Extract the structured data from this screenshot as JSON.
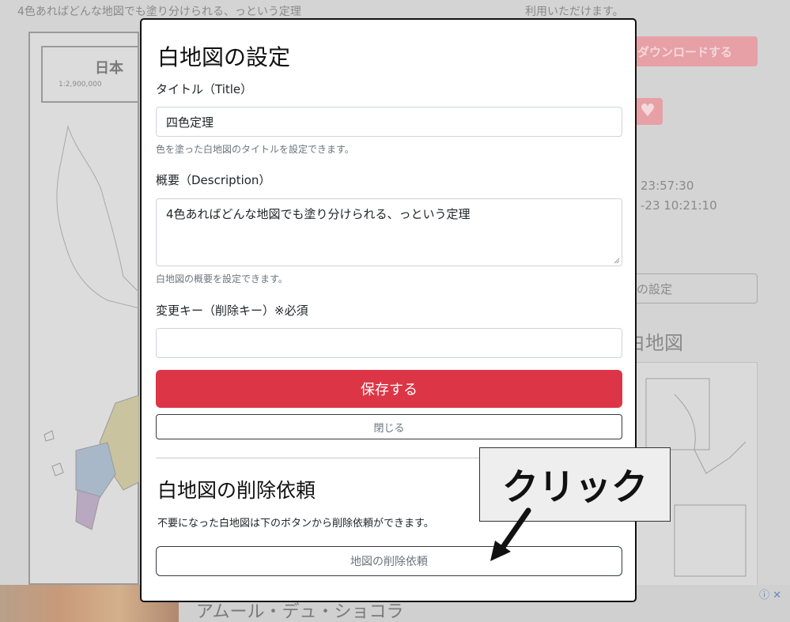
{
  "background": {
    "map_description": "4色あればどんな地図でも塗り分けられる、っという定理",
    "usage_note": "利用いただけます。",
    "map_legend_title": "日本",
    "map_scale": "1:2,900,000",
    "download_button": "でダウンロードする",
    "created_at": "23:57:30",
    "updated_at": "-23 10:21:10",
    "settings_button": "の設定",
    "related_heading": "白地図",
    "ad_text": "アムール・デュ・ショコラ",
    "ad_icons": "ⓘ ✕"
  },
  "modal": {
    "title": "白地図の設定",
    "title_field": {
      "label": "タイトル（Title）",
      "value": "四色定理",
      "help": "色を塗った白地図のタイトルを設定できます。"
    },
    "description_field": {
      "label": "概要（Description）",
      "value": "4色あればどんな地図でも塗り分けられる、っという定理",
      "help": "白地図の概要を設定できます。"
    },
    "key_field": {
      "label": "変更キー（削除キー）※必須",
      "value": ""
    },
    "save_button": "保存する",
    "close_button": "閉じる",
    "delete_section": {
      "title": "白地図の削除依頼",
      "description": "不要になった白地図は下のボタンから削除依頼ができます。",
      "button": "地図の削除依頼"
    }
  },
  "annotation": {
    "callout_text": "クリック"
  },
  "colors": {
    "danger": "#dc3545",
    "overlay": "#d4d4d4"
  }
}
